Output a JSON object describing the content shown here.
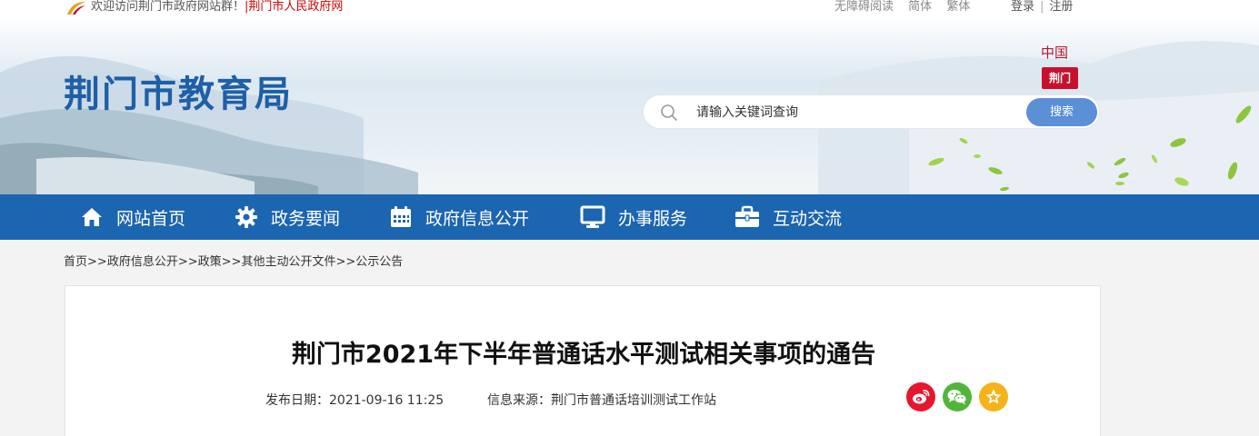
{
  "topbar": {
    "welcome_text": "欢迎访问荆门市政府网站群！",
    "portal_link": "荆门市人民政府网",
    "accessibility": "无障碍阅读",
    "simplified": "简体",
    "traditional": "繁体",
    "login": "登录",
    "divider": "|",
    "register": "注册"
  },
  "header": {
    "site_title": "荆门市教育局",
    "seal_text": "中国",
    "seal_stamp": "荆门"
  },
  "search": {
    "placeholder": "请输入关键词查询",
    "button": "搜索"
  },
  "nav": {
    "items": [
      {
        "label": "网站首页",
        "icon": "home-icon"
      },
      {
        "label": "政务要闻",
        "icon": "gear-icon"
      },
      {
        "label": "政府信息公开",
        "icon": "calendar-icon"
      },
      {
        "label": "办事服务",
        "icon": "monitor-icon"
      },
      {
        "label": "互动交流",
        "icon": "briefcase-icon"
      }
    ]
  },
  "breadcrumb": {
    "items": [
      "首页",
      "政府信息公开",
      "政策",
      "其他主动公开文件",
      "公示公告"
    ],
    "separator": ">>"
  },
  "article": {
    "title": "荆门市2021年下半年普通话水平测试相关事项的通告",
    "date_label": "发布日期：2021-09-16 11:25",
    "source_label": "信息来源：荆门市普通话培训测试工作站"
  },
  "share": [
    {
      "icon": "weibo-icon",
      "color": "#e6162d"
    },
    {
      "icon": "wechat-icon",
      "color": "#51b53a"
    },
    {
      "icon": "favorite-star-icon",
      "color": "#f6b21b"
    }
  ],
  "colors": {
    "brand_blue": "#1c65b0",
    "title_blue": "#1e5fa7",
    "search_button": "#5b8fd6",
    "accent_red": "#c00000"
  }
}
